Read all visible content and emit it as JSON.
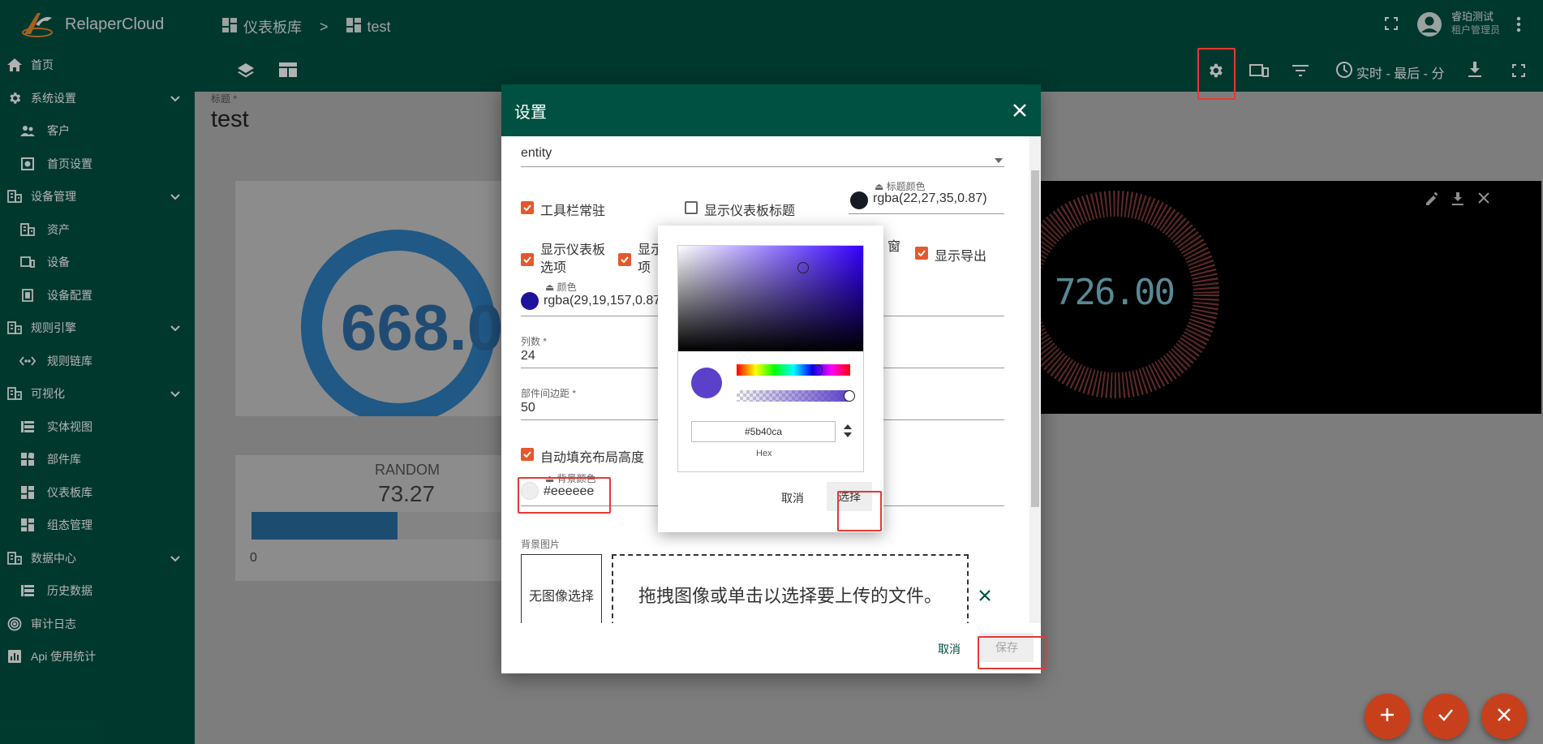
{
  "app": {
    "name": "RelaperCloud"
  },
  "sidebar": {
    "items": [
      {
        "label": "首页",
        "icon": "home-icon",
        "level": "top"
      },
      {
        "label": "系统设置",
        "icon": "gear-icon",
        "level": "top",
        "expandable": true
      },
      {
        "label": "客户",
        "icon": "people-icon",
        "level": "sub"
      },
      {
        "label": "首页设置",
        "icon": "home-settings-icon",
        "level": "sub"
      },
      {
        "label": "设备管理",
        "icon": "building-icon",
        "level": "top",
        "expandable": true
      },
      {
        "label": "资产",
        "icon": "building-icon",
        "level": "sub"
      },
      {
        "label": "设备",
        "icon": "devices-icon",
        "level": "sub"
      },
      {
        "label": "设备配置",
        "icon": "device-profile-icon",
        "level": "sub"
      },
      {
        "label": "规则引擎",
        "icon": "building-icon",
        "level": "top",
        "expandable": true
      },
      {
        "label": "规则链库",
        "icon": "code-icon",
        "level": "sub"
      },
      {
        "label": "可视化",
        "icon": "building-icon",
        "level": "top",
        "expandable": true
      },
      {
        "label": "实体视图",
        "icon": "view-icon",
        "level": "sub"
      },
      {
        "label": "部件库",
        "icon": "widgets-icon",
        "level": "sub"
      },
      {
        "label": "仪表板库",
        "icon": "dashboard-icon",
        "level": "sub"
      },
      {
        "label": "组态管理",
        "icon": "dashboard-icon",
        "level": "sub"
      },
      {
        "label": "数据中心",
        "icon": "building-icon",
        "level": "top",
        "expandable": true
      },
      {
        "label": "历史数据",
        "icon": "view-icon",
        "level": "sub"
      },
      {
        "label": "审计日志",
        "icon": "track-icon",
        "level": "top"
      },
      {
        "label": "Api 使用统计",
        "icon": "chart-icon",
        "level": "top"
      }
    ]
  },
  "topbar": {
    "breadcrumb": [
      "仪表板库",
      "test"
    ],
    "breadcrumb_sep": ">",
    "user": {
      "name": "睿珀测试",
      "role": "租户管理员"
    },
    "time_window": "实时 - 最后 - 分"
  },
  "dashboard": {
    "title_label": "标题 *",
    "title": "test",
    "card_gauge_value": "668.0",
    "card_random": {
      "title": "RANDOM",
      "value": "73.27",
      "min": "0",
      "progress": 0.5
    },
    "card_digital_value": "726.00"
  },
  "dialog": {
    "title": "设置",
    "entity_value": "entity",
    "checkboxes": {
      "toolbar_sticky": {
        "label": "工具栏常驻",
        "checked": true
      },
      "show_title": {
        "label": "显示仪表板标题",
        "checked": false
      },
      "show_options": {
        "label_l1": "显示仪表板",
        "label_l2": "选项",
        "checked": true
      },
      "show_other": {
        "label_l1": "显示",
        "label_l2": "项",
        "checked": true
      },
      "window": {
        "label": "窗",
        "checked": false
      },
      "show_export": {
        "label": "显示导出",
        "checked": true
      },
      "autofill": {
        "label": "自动填充布局高度",
        "checked": true
      }
    },
    "title_color": {
      "label": "标题颜色",
      "value": "rgba(22,27,35,0.87)",
      "swatch": "#161b23"
    },
    "color": {
      "label": "颜色",
      "value": "rgba(29,19,157,0.87)",
      "swatch": "#1d139d"
    },
    "columns": {
      "label": "列数 *",
      "value": "24"
    },
    "margin": {
      "label": "部件间边距 *",
      "value": "50"
    },
    "bg_color": {
      "label": "背景颜色",
      "value": "#eeeeee",
      "swatch": "#eeeeee"
    },
    "bg_image": {
      "label": "背景图片",
      "no_image": "无图像选择",
      "drop_hint": "拖拽图像或单击以选择要上传的文件。"
    },
    "cancel": "取消",
    "save": "保存"
  },
  "color_picker": {
    "hex": "#5b40ca",
    "hex_label": "Hex",
    "preview": "#5b40ca",
    "cancel": "取消",
    "select": "选择"
  },
  "colors": {
    "primary": "#005142",
    "accent": "#e4592b",
    "fab": "#c8401b",
    "highlight": "#e53935"
  }
}
